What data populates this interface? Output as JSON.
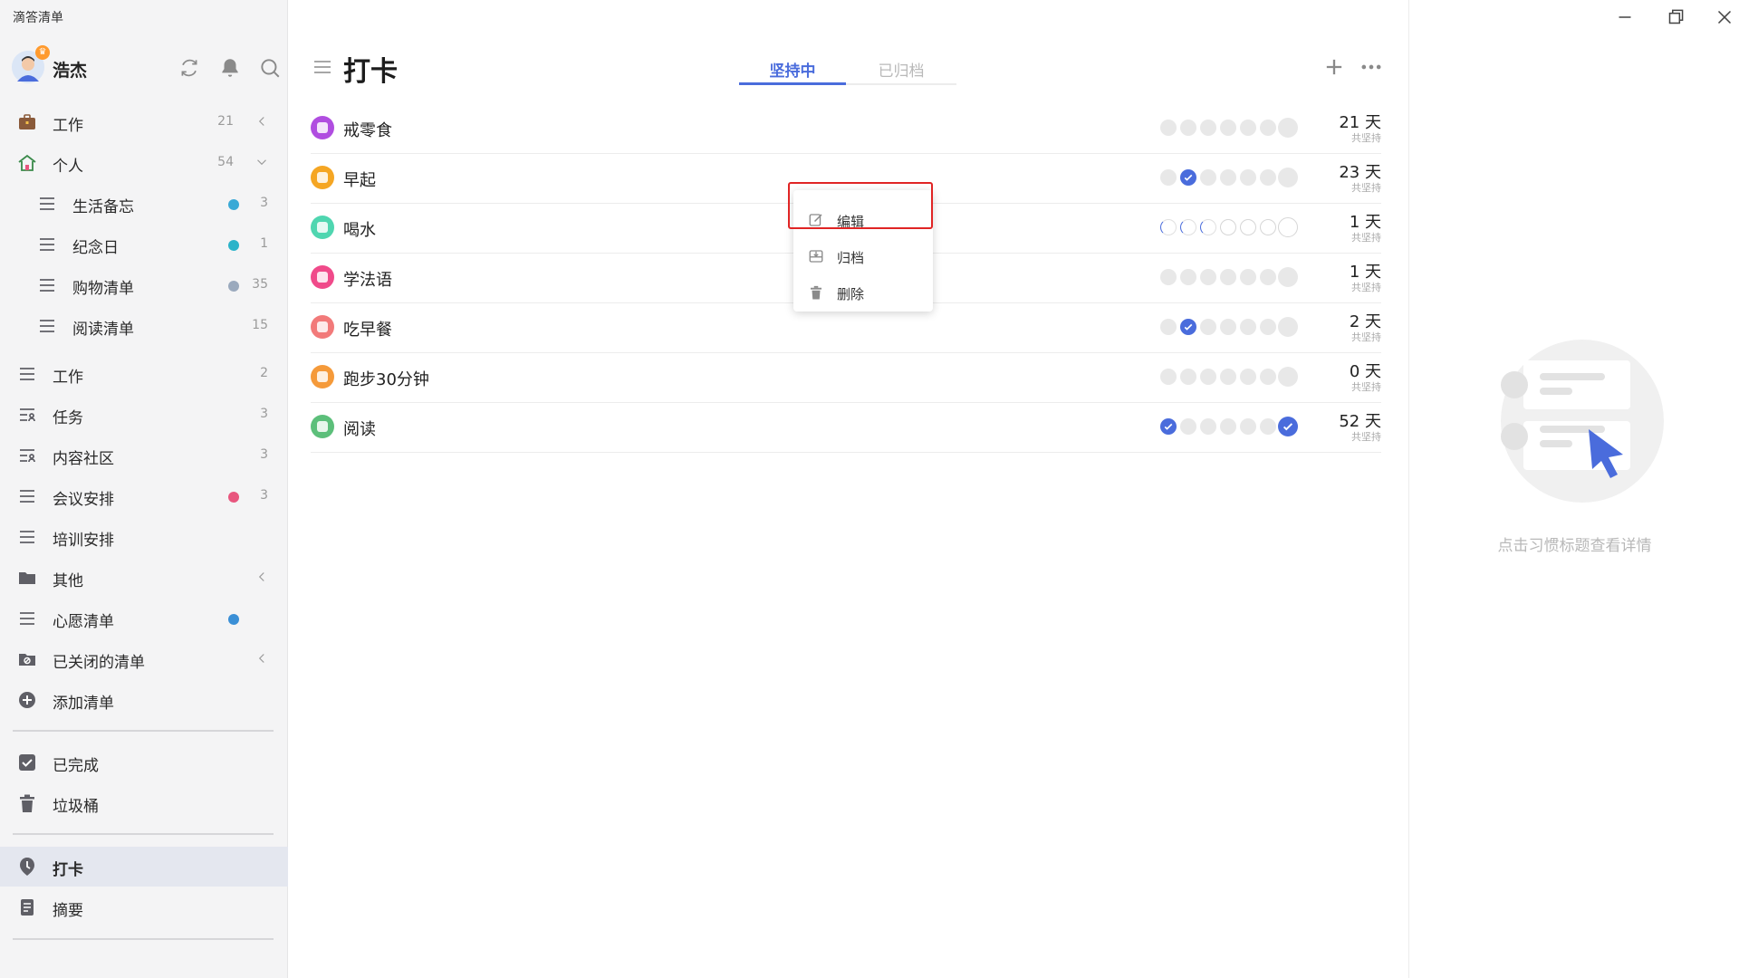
{
  "app": {
    "title": "滴答清单"
  },
  "user": {
    "name": "浩杰"
  },
  "sidebar": {
    "items": [
      {
        "label": "工作",
        "count": "21",
        "icon": "briefcase-icon",
        "chevron": "left"
      },
      {
        "label": "个人",
        "count": "54",
        "icon": "home-icon",
        "chevron": "down"
      },
      {
        "label": "生活备忘",
        "count": "3",
        "icon": "list-icon",
        "dot": "#3aa9d6",
        "sub": true
      },
      {
        "label": "纪念日",
        "count": "1",
        "icon": "list-icon",
        "dot": "#2bb3c9",
        "sub": true
      },
      {
        "label": "购物清单",
        "count": "35",
        "icon": "list-icon",
        "dot": "#9aa9bd",
        "sub": true
      },
      {
        "label": "阅读清单",
        "count": "15",
        "icon": "list-icon",
        "sub": true
      },
      {
        "label": "工作",
        "count": "2",
        "icon": "list-icon"
      },
      {
        "label": "任务",
        "count": "3",
        "icon": "shared-list-icon"
      },
      {
        "label": "内容社区",
        "count": "3",
        "icon": "shared-list-icon"
      },
      {
        "label": "会议安排",
        "count": "3",
        "icon": "list-icon",
        "dot": "#e8567e"
      },
      {
        "label": "培训安排",
        "icon": "list-icon"
      },
      {
        "label": "其他",
        "icon": "folder-icon",
        "chevron": "left"
      },
      {
        "label": "心愿清单",
        "icon": "list-icon",
        "dot": "#3a8fd6"
      },
      {
        "label": "已关闭的清单",
        "icon": "closed-folder-icon",
        "chevron": "left"
      },
      {
        "label": "添加清单",
        "icon": "add-circle-icon"
      }
    ],
    "completed": "已完成",
    "trash": "垃圾桶",
    "habit": "打卡",
    "summary": "摘要"
  },
  "main": {
    "title": "打卡",
    "tabs": [
      {
        "label": "坚持中"
      },
      {
        "label": "已归档"
      }
    ],
    "habits": [
      {
        "name": "戒零食",
        "days": "21 天",
        "sub": "共坚持",
        "color": "#b04de0",
        "week": [
          "e",
          "e",
          "e",
          "e",
          "e",
          "e",
          "E"
        ]
      },
      {
        "name": "早起",
        "days": "23 天",
        "sub": "共坚持",
        "color": "#f5a623",
        "week": [
          "e",
          "c",
          "e",
          "e",
          "e",
          "e",
          "E"
        ]
      },
      {
        "name": "喝水",
        "days": "1 天",
        "sub": "共坚持",
        "color": "#4fd6b0",
        "week": [
          "p",
          "p",
          "p",
          "r",
          "r",
          "r",
          "R"
        ]
      },
      {
        "name": "学法语",
        "days": "1 天",
        "sub": "共坚持",
        "color": "#f04a8a",
        "week": [
          "e",
          "e",
          "e",
          "e",
          "e",
          "e",
          "E"
        ]
      },
      {
        "name": "吃早餐",
        "days": "2 天",
        "sub": "共坚持",
        "color": "#f27a7a",
        "week": [
          "e",
          "c",
          "e",
          "e",
          "e",
          "e",
          "E"
        ]
      },
      {
        "name": "跑步30分钟",
        "days": "0 天",
        "sub": "共坚持",
        "color": "#f59a3a",
        "week": [
          "e",
          "e",
          "e",
          "e",
          "e",
          "e",
          "E"
        ]
      },
      {
        "name": "阅读",
        "days": "52 天",
        "sub": "共坚持",
        "color": "#5cbf7a",
        "week": [
          "c",
          "e",
          "e",
          "e",
          "e",
          "e",
          "C"
        ]
      }
    ]
  },
  "context_menu": {
    "items": [
      {
        "label": "编辑",
        "icon": "edit-icon"
      },
      {
        "label": "归档",
        "icon": "archive-icon"
      },
      {
        "label": "删除",
        "icon": "trash-icon"
      }
    ]
  },
  "detail": {
    "empty_hint": "点击习惯标题查看详情"
  },
  "colors": {
    "accent": "#4a6cdc",
    "highlight": "#e02424"
  }
}
